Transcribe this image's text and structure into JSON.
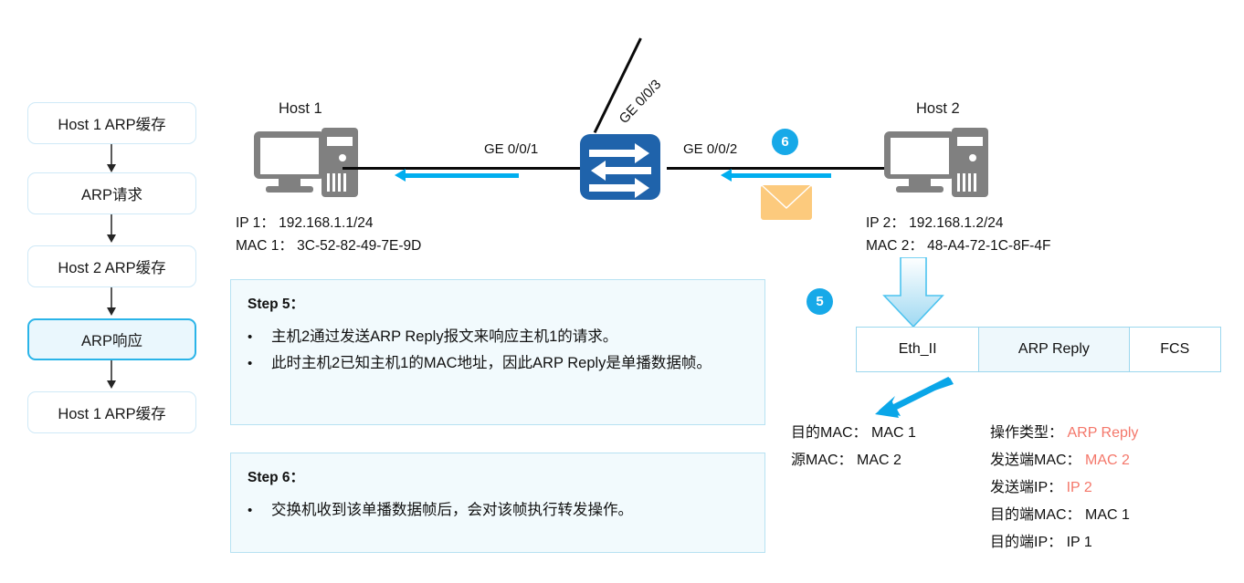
{
  "flow": {
    "items": [
      {
        "label": "Host 1 ARP缓存",
        "active": false
      },
      {
        "label": "ARP请求",
        "active": false
      },
      {
        "label": "Host 2 ARP缓存",
        "active": false
      },
      {
        "label": "ARP响应",
        "active": true
      },
      {
        "label": "Host 1 ARP缓存",
        "active": false
      }
    ]
  },
  "topology": {
    "host1": {
      "title": "Host 1",
      "ip": "IP 1： 192.168.1.1/24",
      "mac": "MAC 1： 3C-52-82-49-7E-9D"
    },
    "host2": {
      "title": "Host 2",
      "ip": "IP 2： 192.168.1.2/24",
      "mac": "MAC 2： 48-A4-72-1C-8F-4F"
    },
    "interfaces": {
      "left": "GE 0/0/1",
      "right": "GE 0/0/2",
      "up": "GE 0/0/3"
    },
    "badges": {
      "six": "6",
      "five": "5"
    },
    "colors": {
      "switch": "#1f63ab",
      "badge": "#17a9e8",
      "arrow_cyan": "#00aeef",
      "envelope": "#fcca7d",
      "host_gray": "#808080",
      "accent_red": "#f4776a"
    }
  },
  "steps": [
    {
      "title": "Step 5：",
      "bullets": [
        "主机2通过发送ARP Reply报文来响应主机1的请求。",
        "此时主机2已知主机1的MAC地址，因此ARP Reply是单播数据帧。"
      ]
    },
    {
      "title": "Step 6：",
      "bullets": [
        "交换机收到该单播数据帧后，会对该帧执行转发操作。"
      ]
    }
  ],
  "frame": {
    "cells": [
      "Eth_II",
      "ARP Reply",
      "FCS"
    ]
  },
  "frame_fields": {
    "left": [
      {
        "label": "目的MAC：",
        "value": "MAC 1",
        "red": false
      },
      {
        "label": "源MAC：",
        "value": "MAC 2",
        "red": false
      }
    ],
    "right": [
      {
        "label": "操作类型：",
        "value": "ARP Reply",
        "red": true
      },
      {
        "label": "发送端MAC：",
        "value": "MAC 2",
        "red": true
      },
      {
        "label": "发送端IP：",
        "value": "IP 2",
        "red": true
      },
      {
        "label": "目的端MAC：",
        "value": "MAC 1",
        "red": false
      },
      {
        "label": "目的端IP：",
        "value": "IP 1",
        "red": false
      }
    ]
  }
}
